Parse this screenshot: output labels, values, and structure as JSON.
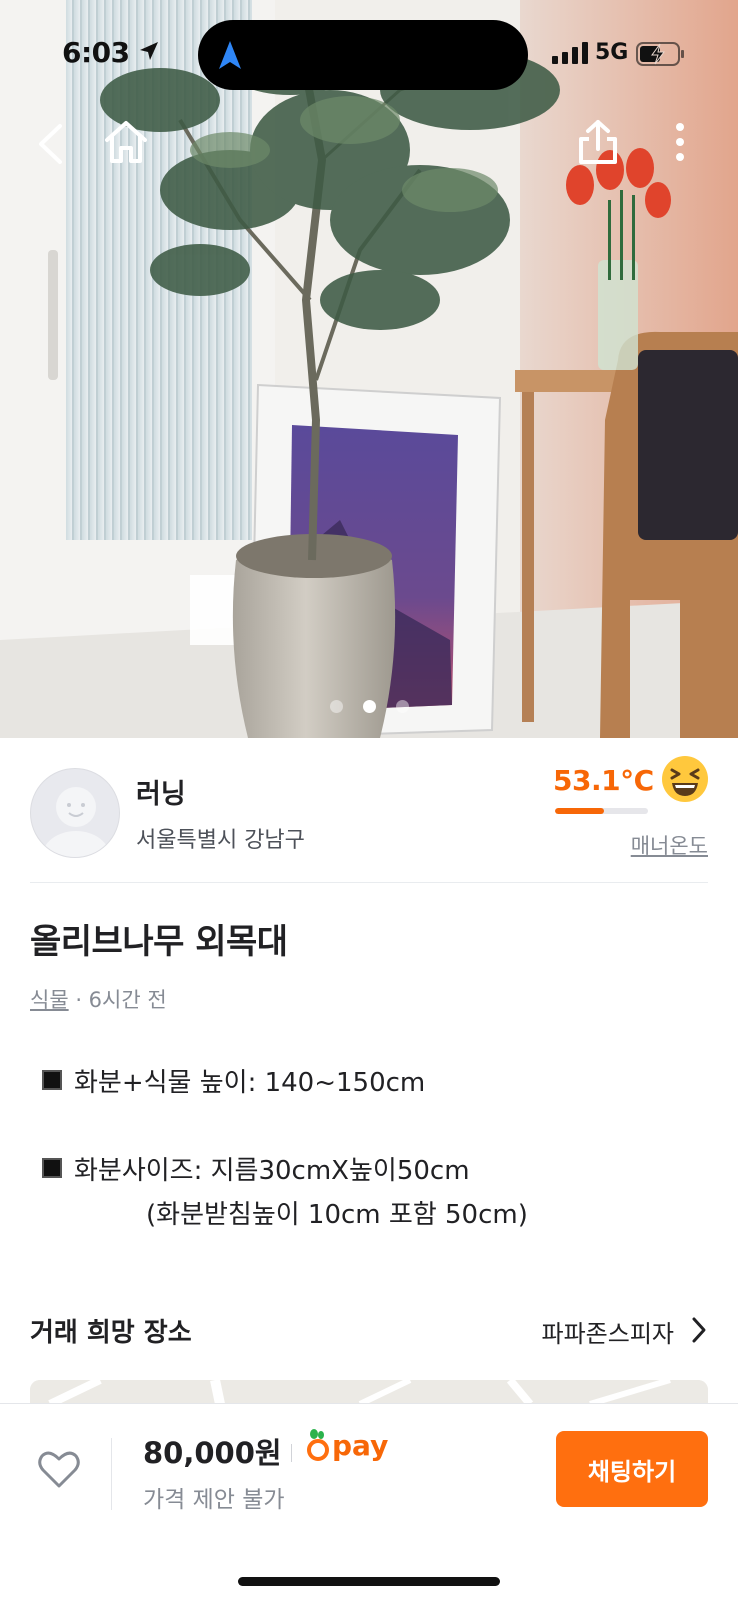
{
  "status_bar": {
    "time": "6:03",
    "network": "5G"
  },
  "nav": {
    "icons": [
      "back-icon",
      "home-icon",
      "share-icon",
      "more-icon"
    ]
  },
  "gallery": {
    "count": 3,
    "active_index": 1
  },
  "seller": {
    "name": "러닝",
    "location": "서울특별시 강남구",
    "temperature": "53.1°C",
    "temperature_fraction": 0.53,
    "temperature_label": "매너온도"
  },
  "item": {
    "title": "올리브나무 외목대",
    "category": "식물",
    "time_ago": "· 6시간 전",
    "description": {
      "line1": "화분+식물 높이: 140~150cm",
      "line2": "화분사이즈: 지름30cmX높이50cm",
      "line3": "(화분받침높이 10cm 포함 50cm)"
    }
  },
  "trade_place": {
    "label": "거래 희망 장소",
    "value": "파파존스피자"
  },
  "bottom_bar": {
    "price": "80,000원",
    "pay_label": "pay",
    "negotiation": "가격 제안 불가",
    "chat_button": "채팅하기"
  },
  "colors": {
    "accent": "#ff6f0f",
    "temperature": "#f76707",
    "muted": "#868b94"
  }
}
